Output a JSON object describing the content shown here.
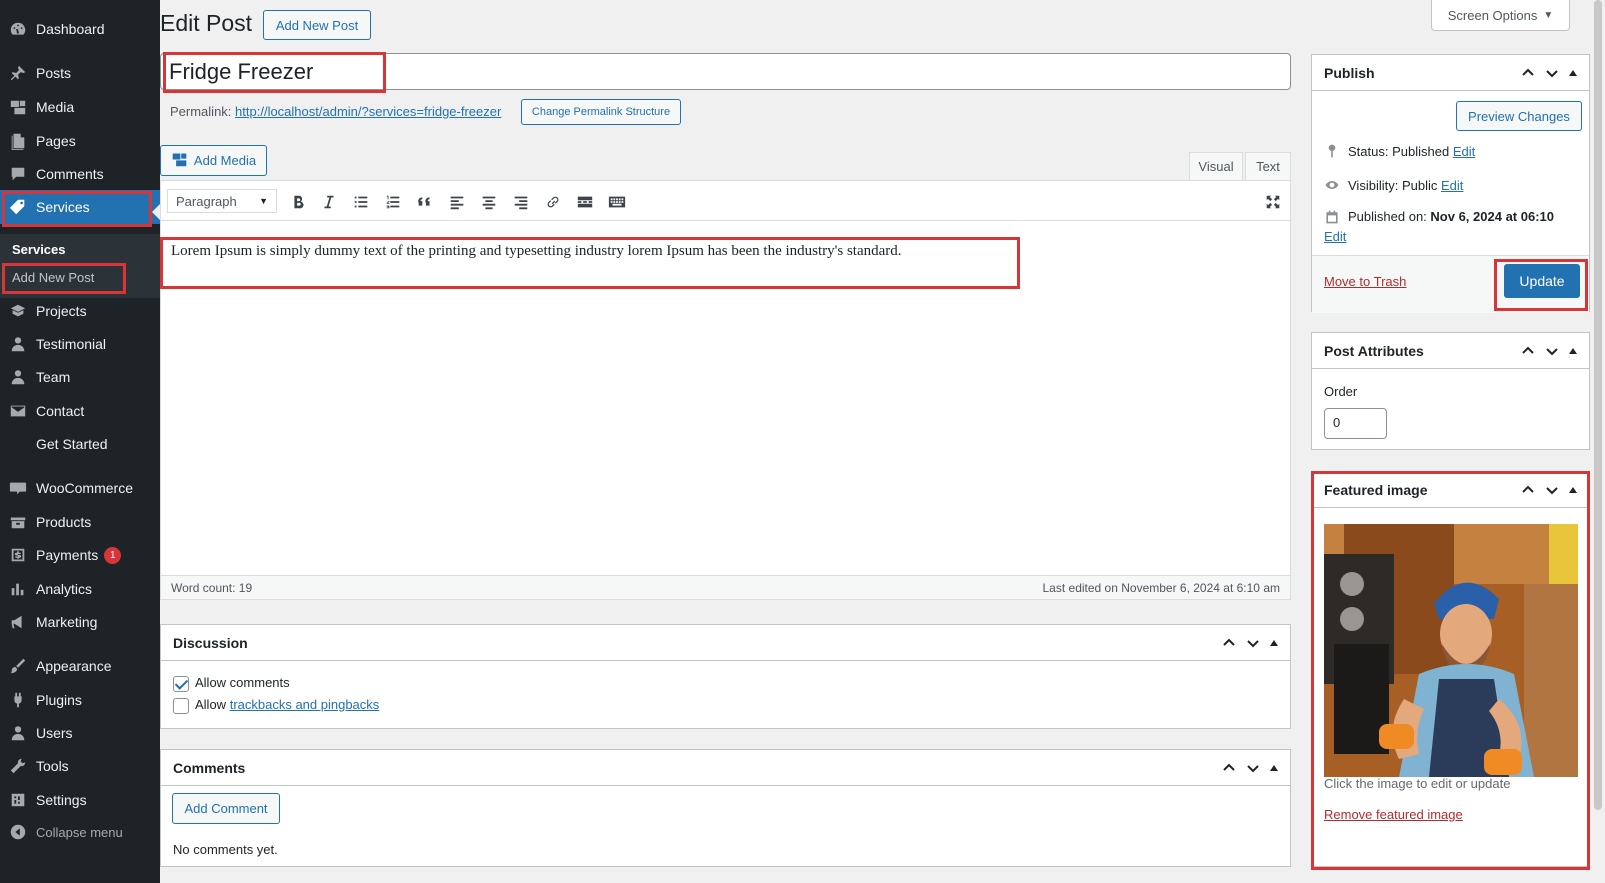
{
  "sidebar": {
    "items": [
      {
        "label": "Dashboard",
        "icon": "dashboard-icon"
      },
      {
        "label": "Posts",
        "icon": "pin-icon"
      },
      {
        "label": "Media",
        "icon": "media-icon"
      },
      {
        "label": "Pages",
        "icon": "pages-icon"
      },
      {
        "label": "Comments",
        "icon": "comments-icon"
      },
      {
        "label": "Services",
        "icon": "tag-icon"
      },
      {
        "label": "Projects",
        "icon": "projects-icon"
      },
      {
        "label": "Testimonial",
        "icon": "person-icon"
      },
      {
        "label": "Team",
        "icon": "person-icon"
      },
      {
        "label": "Contact",
        "icon": "mail-icon"
      },
      {
        "label": "Get Started",
        "icon": ""
      },
      {
        "label": "WooCommerce",
        "icon": "woo-icon"
      },
      {
        "label": "Products",
        "icon": "products-icon"
      },
      {
        "label": "Payments",
        "icon": "payments-icon",
        "badge": "1"
      },
      {
        "label": "Analytics",
        "icon": "analytics-icon"
      },
      {
        "label": "Marketing",
        "icon": "megaphone-icon"
      },
      {
        "label": "Appearance",
        "icon": "brush-icon"
      },
      {
        "label": "Plugins",
        "icon": "plug-icon"
      },
      {
        "label": "Users",
        "icon": "users-icon"
      },
      {
        "label": "Tools",
        "icon": "wrench-icon"
      },
      {
        "label": "Settings",
        "icon": "settings-icon"
      }
    ],
    "submenu_heading": "Services",
    "submenu_item": "Add New Post",
    "collapse_label": "Collapse menu"
  },
  "header": {
    "title": "Edit Post",
    "add_new": "Add New Post",
    "screen_options": "Screen Options"
  },
  "post": {
    "title": "Fridge Freezer",
    "permalink_label": "Permalink:",
    "permalink_url": "http://localhost/admin/?services=fridge-freezer",
    "change_permalink": "Change Permalink Structure",
    "add_media": "Add Media",
    "tab_visual": "Visual",
    "tab_text": "Text",
    "format": "Paragraph",
    "content": "Lorem Ipsum is simply dummy text of the printing and typesetting industry lorem Ipsum has been the industry's standard.",
    "word_count": "Word count: 19",
    "last_edited": "Last edited on November 6, 2024 at 6:10 am"
  },
  "discussion": {
    "title": "Discussion",
    "allow_comments": "Allow comments",
    "allow_prefix": "Allow",
    "trackbacks_link": "trackbacks and pingbacks"
  },
  "comments": {
    "title": "Comments",
    "add_button": "Add Comment",
    "none": "No comments yet."
  },
  "publish": {
    "title": "Publish",
    "preview": "Preview Changes",
    "status_label": "Status:",
    "status_value": "Published",
    "visibility_label": "Visibility:",
    "visibility_value": "Public",
    "published_on_label": "Published on:",
    "published_on_value": "Nov 6, 2024 at 06:10",
    "edit": "Edit",
    "trash": "Move to Trash",
    "update": "Update"
  },
  "attributes": {
    "title": "Post Attributes",
    "order_label": "Order",
    "order_value": "0"
  },
  "featured": {
    "title": "Featured image",
    "hint": "Click the image to edit or update",
    "remove": "Remove featured image"
  },
  "colors": {
    "accent": "#2271b1",
    "highlight": "#d63638",
    "sidebar": "#1d2327"
  }
}
